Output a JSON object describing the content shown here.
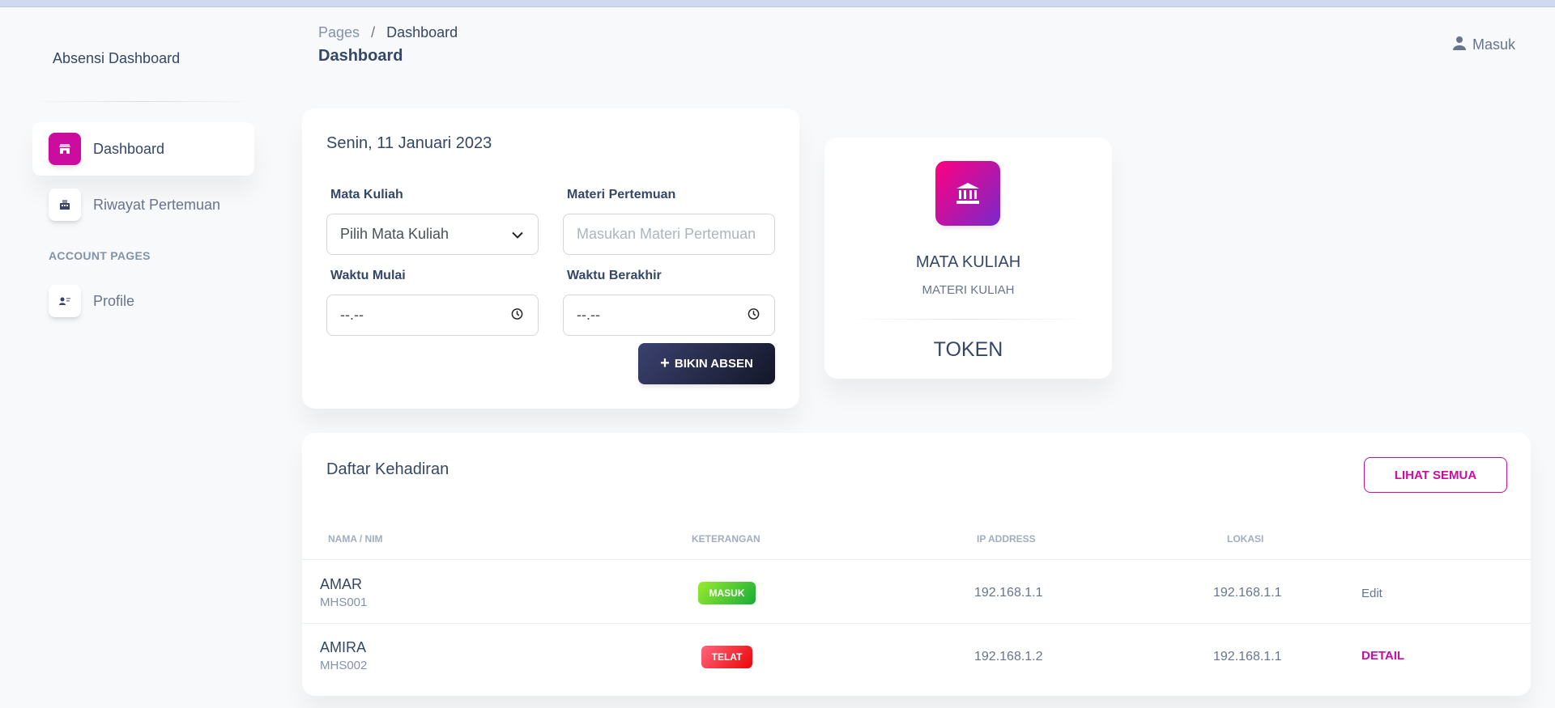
{
  "sidebar": {
    "brand": "Absensi Dashboard",
    "items": [
      {
        "label": "Dashboard"
      },
      {
        "label": "Riwayat Pertemuan"
      }
    ],
    "section_title": "ACCOUNT PAGES",
    "account_items": [
      {
        "label": "Profile"
      }
    ]
  },
  "header": {
    "breadcrumb_root": "Pages",
    "breadcrumb_sep": "/",
    "breadcrumb_current": "Dashboard",
    "title": "Dashboard",
    "signin_label": "Masuk"
  },
  "form": {
    "date": "Senin, 11 Januari 2023",
    "course_label": "Mata Kuliah",
    "course_value": "Pilih Mata Kuliah",
    "material_label": "Materi Pertemuan",
    "material_placeholder": "Masukan Materi Pertemuan",
    "start_label": "Waktu Mulai",
    "start_value": "--.--",
    "end_label": "Waktu Berakhir",
    "end_value": "--.--",
    "create_label": "BIKIN ABSEN"
  },
  "course_card": {
    "name": "MATA KULIAH",
    "material": "MATERI KULIAH",
    "token": "TOKEN"
  },
  "attendance": {
    "title": "Daftar Kehadiran",
    "view_all_label": "LIHAT SEMUA",
    "columns": [
      "NAMA / NIM",
      "KETERANGAN",
      "IP ADDRESS",
      "LOKASI"
    ],
    "rows": [
      {
        "name": "AMAR",
        "nim": "MHS001",
        "status": "MASUK",
        "ip": "192.168.1.1",
        "location": "192.168.1.1",
        "action": "Edit"
      },
      {
        "name": "AMIRA",
        "nim": "MHS002",
        "status": "TELAT",
        "ip": "192.168.1.2",
        "location": "192.168.1.1",
        "action": "DETAIL"
      }
    ]
  },
  "colors": {
    "primary": "#cb0c9f",
    "dark": "#344767",
    "success": "#82d616",
    "danger": "#ea0606"
  }
}
